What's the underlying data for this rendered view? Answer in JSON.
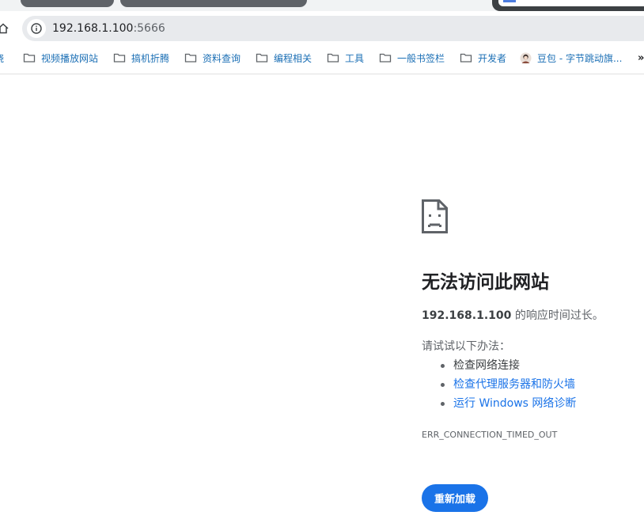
{
  "browser": {
    "address_bar": {
      "host": "192.168.1.100",
      "port": ":5666"
    },
    "bookmarks": {
      "cut_label": "烧",
      "items": [
        {
          "label": "视频播放网站",
          "icon": "folder-icon"
        },
        {
          "label": "搞机折腾",
          "icon": "folder-icon"
        },
        {
          "label": "资料查询",
          "icon": "folder-icon"
        },
        {
          "label": "编程相关",
          "icon": "folder-icon"
        },
        {
          "label": "工具",
          "icon": "folder-icon"
        },
        {
          "label": "一般书签栏",
          "icon": "folder-icon"
        },
        {
          "label": "开发者",
          "icon": "folder-icon"
        },
        {
          "label": "豆包 - 字节跳动旗...",
          "icon": "doubao-avatar-icon"
        }
      ],
      "overflow": "»"
    }
  },
  "error_page": {
    "title": "无法访问此网站",
    "host": "192.168.1.100",
    "description_suffix": " 的响应时间过长。",
    "try_label": "请试试以下办法：",
    "suggestions": [
      {
        "label": "检查网络连接",
        "link": false
      },
      {
        "label": "检查代理服务器和防火墙",
        "link": true
      },
      {
        "label": "运行 Windows 网络诊断",
        "link": true
      }
    ],
    "error_code": "ERR_CONNECTION_TIMED_OUT",
    "reload_label": "重新加载"
  },
  "colors": {
    "accent": "#1a73e8",
    "bookmark_text": "#1b6fb5",
    "omnibox_bg": "#e8eaed"
  }
}
